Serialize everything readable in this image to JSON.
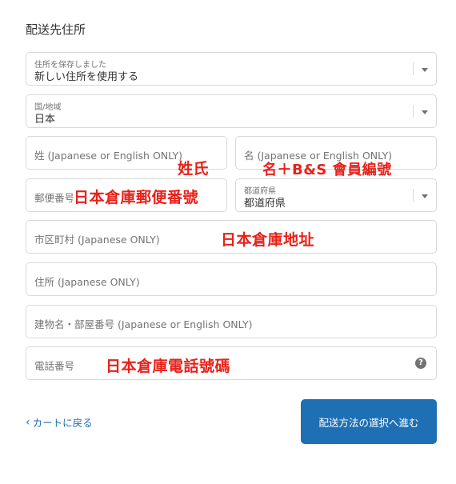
{
  "heading": "配送先住所",
  "saved_address": {
    "label": "住所を保存しました",
    "value": "新しい住所を使用する"
  },
  "country": {
    "label": "国/地域",
    "value": "日本"
  },
  "last_name": {
    "placeholder": "姓 (Japanese or English ONLY)",
    "overlay": "姓氏"
  },
  "first_name": {
    "placeholder": "名 (Japanese or English ONLY)",
    "overlay": "名＋B&S 會員編號"
  },
  "postal_code": {
    "placeholder": "郵便番号",
    "overlay": "日本倉庫郵便番號"
  },
  "prefecture": {
    "label": "都道府県",
    "value": "都道府県"
  },
  "city": {
    "placeholder": "市区町村 (Japanese ONLY)",
    "overlay": "日本倉庫地址"
  },
  "address": {
    "placeholder": "住所 (Japanese ONLY)"
  },
  "building": {
    "placeholder": "建物名・部屋番号 (Japanese or English ONLY)"
  },
  "phone": {
    "placeholder": "電話番号",
    "overlay": "日本倉庫電話號碼",
    "help_icon": "question-circle-icon"
  },
  "footer": {
    "back_label": "カートに戻る",
    "continue_label": "配送方法の選択へ進む"
  },
  "colors": {
    "accent": "#1f6fb5",
    "overlay_red": "#e8211a"
  }
}
